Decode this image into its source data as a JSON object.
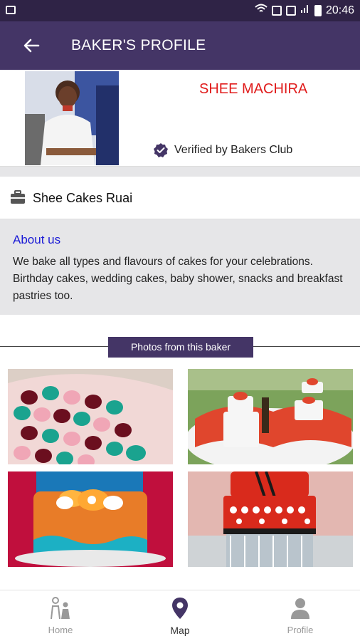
{
  "status_bar": {
    "time": "20:46"
  },
  "header": {
    "title": "BAKER'S PROFILE"
  },
  "profile": {
    "name": "SHEE MACHIRA",
    "verified_text": "Verified by Bakers Club"
  },
  "shop": {
    "name": "Shee Cakes Ruai"
  },
  "about": {
    "heading": "About us",
    "text": "We bake all types and flavours of cakes for your celebrations. Birthday cakes, wedding cakes, baby shower, snacks and breakfast pastries too."
  },
  "photos": {
    "label": "Photos from this baker"
  },
  "bottom_nav": [
    {
      "label": "Home",
      "icon": "family-home-icon",
      "active": false
    },
    {
      "label": "Map",
      "icon": "map-pin-icon",
      "active": true
    },
    {
      "label": "Profile",
      "icon": "person-icon",
      "active": false
    }
  ],
  "colors": {
    "status_bar": "#2f2346",
    "app_bar": "#443566",
    "name": "#e01b1b",
    "about_heading": "#1a1ad6"
  }
}
